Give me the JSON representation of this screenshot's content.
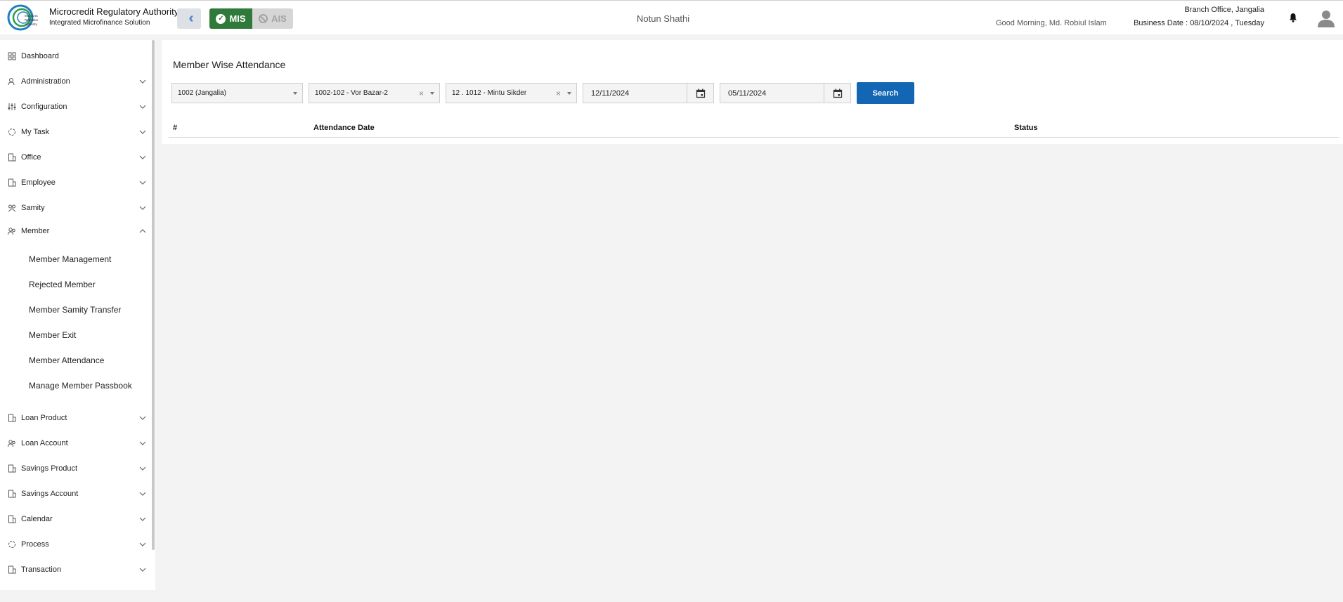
{
  "header": {
    "org_title": "Microcredit Regulatory Authority",
    "org_subtitle": "Integrated Microfinance Solution",
    "logo_text": "Microcredit Regulatory Authority",
    "modes": {
      "active": "MIS",
      "inactive": "AIS"
    },
    "project_name": "Notun Shathi",
    "greeting": "Good Morning, Md. Robiul Islam",
    "branch": "Branch Office, Jangalia",
    "business_date": "Business Date : 08/10/2024 , Tuesday"
  },
  "sidebar": {
    "items": [
      {
        "label": "Dashboard",
        "icon": "dashboard-icon",
        "expandable": false
      },
      {
        "label": "Administration",
        "icon": "administration-icon",
        "expandable": true
      },
      {
        "label": "Configuration",
        "icon": "configuration-icon",
        "expandable": true
      },
      {
        "label": "My Task",
        "icon": "task-icon",
        "expandable": true
      },
      {
        "label": "Office",
        "icon": "office-icon",
        "expandable": true
      },
      {
        "label": "Employee",
        "icon": "employee-icon",
        "expandable": true
      },
      {
        "label": "Samity",
        "icon": "samity-icon",
        "expandable": true
      },
      {
        "label": "Member",
        "icon": "member-icon",
        "expandable": true,
        "expanded": true
      },
      {
        "label": "Loan Product",
        "icon": "loan-product-icon",
        "expandable": true
      },
      {
        "label": "Loan Account",
        "icon": "loan-account-icon",
        "expandable": true
      },
      {
        "label": "Savings Product",
        "icon": "savings-product-icon",
        "expandable": true
      },
      {
        "label": "Savings Account",
        "icon": "savings-account-icon",
        "expandable": true
      },
      {
        "label": "Calendar",
        "icon": "calendar-icon",
        "expandable": true
      },
      {
        "label": "Process",
        "icon": "process-icon",
        "expandable": true
      },
      {
        "label": "Transaction",
        "icon": "transaction-icon",
        "expandable": true
      }
    ],
    "member_submenu": [
      "Member Management",
      "Rejected Member",
      "Member Samity Transfer",
      "Member Exit",
      "Member Attendance",
      "Manage Member Passbook"
    ]
  },
  "main": {
    "title": "Member Wise Attendance",
    "filters": {
      "office": "1002 (Jangalia)",
      "samity": "1002-102 - Vor Bazar-2",
      "member": "12 . 1012 - Mintu Sikder",
      "date_from": "12/11/2024",
      "date_to": "05/11/2024"
    },
    "search_label": "Search",
    "table": {
      "columns": [
        "#",
        "Attendance Date",
        "Status"
      ],
      "rows": []
    }
  },
  "colors": {
    "primary": "#1266b4",
    "mis_green": "#2f7a3a",
    "background": "#f3f3f3"
  }
}
